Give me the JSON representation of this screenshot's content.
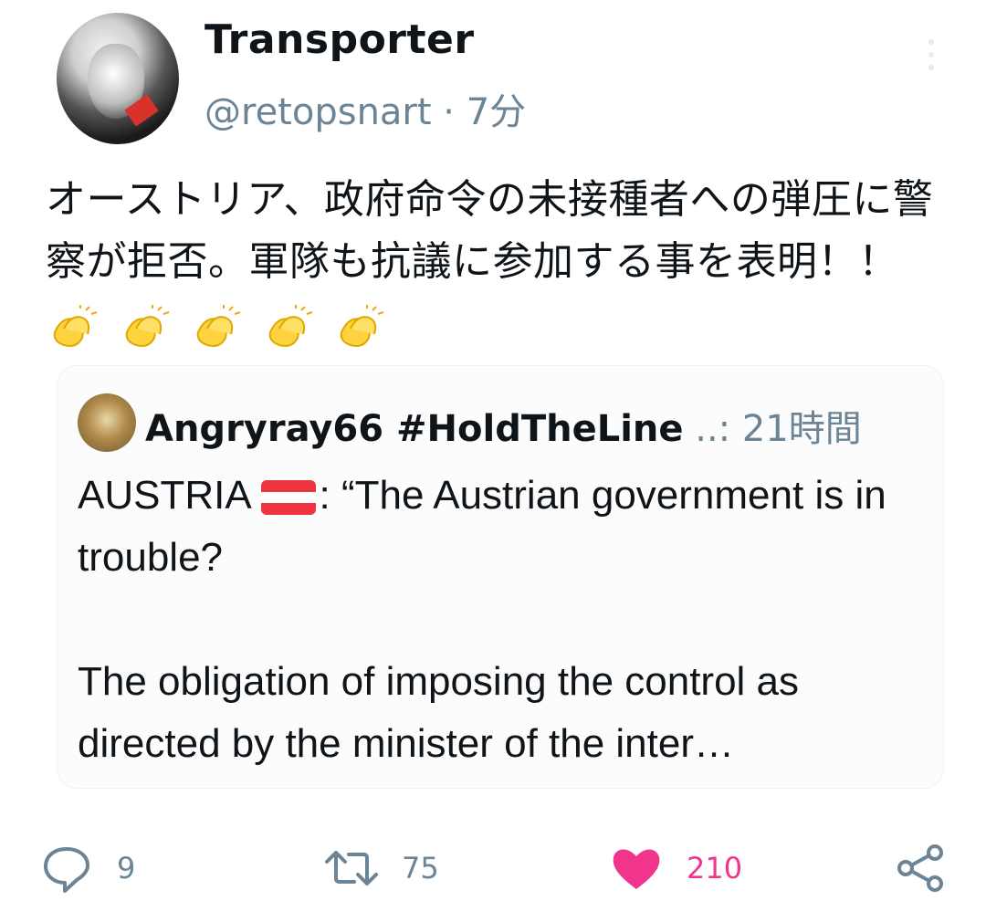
{
  "author": {
    "display_name": "Transporter",
    "handle": "@retopsnart",
    "separator": "·",
    "time": "7分"
  },
  "tweet": {
    "text": "オーストリア、政府命令の未接種者への弾圧に警察が拒否。軍隊も抗議に参加する事を表明！！",
    "emoji": [
      "clapping-hands",
      "clapping-hands",
      "clapping-hands",
      "clapping-hands",
      "clapping-hands"
    ]
  },
  "quote": {
    "name": "Angryray66 #HoldTheLine",
    "time": "..: 21時間",
    "text_prefix": "AUSTRIA",
    "text_body": ": “The Austrian government is in trouble?\n\nThe obligation of imposing the control as directed by the minister of the inter…",
    "flag": "austria-flag"
  },
  "actions": {
    "reply_count": "9",
    "retweet_count": "75",
    "like_count": "210"
  },
  "colors": {
    "muted": "#6b8596",
    "like": "#f2358c",
    "flag_red": "#ef3340"
  }
}
